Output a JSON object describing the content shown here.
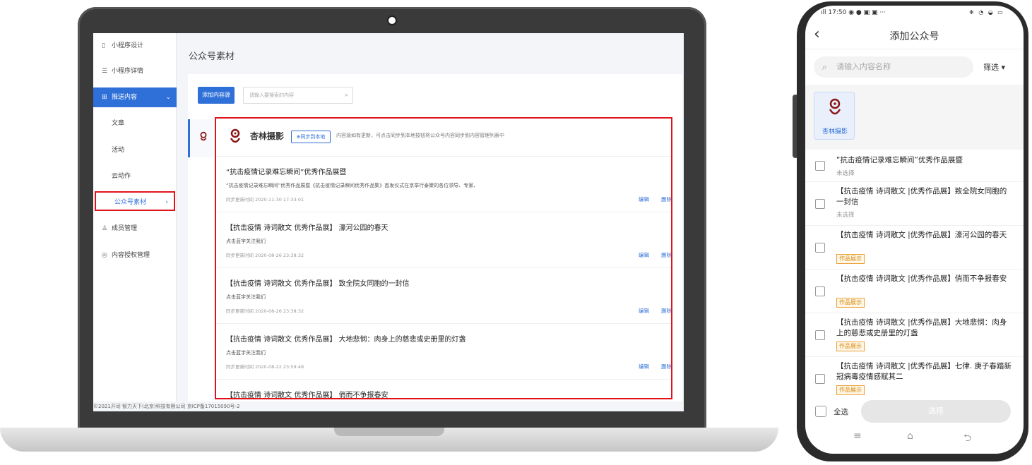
{
  "laptop": {
    "sidebar": {
      "items": [
        {
          "icon": "mini-program-icon",
          "glyph": "▯",
          "label": "小程序设计"
        },
        {
          "icon": "list-icon",
          "glyph": "☰",
          "label": "小程序详情"
        },
        {
          "icon": "content-icon",
          "glyph": "⊞",
          "label": "推送内容",
          "chevron": "⌄"
        },
        {
          "label": "文章"
        },
        {
          "label": "活动"
        },
        {
          "label": "云动作"
        },
        {
          "label": "公众号素材",
          "chevron": "›"
        },
        {
          "icon": "member-icon",
          "glyph": "♙",
          "label": "成员管理"
        },
        {
          "icon": "permission-icon",
          "glyph": "◎",
          "label": "内容授权管理"
        }
      ]
    },
    "footer": "©2021开司 智力天下(北京)科技有限公司 京ICP备17015090号-2",
    "page_title": "公众号素材",
    "add_button": "添加内容源",
    "search_placeholder": "请输入要搜索的内容",
    "account": {
      "name": "杏林摄影",
      "sync_label": "⊕同步到本地",
      "tip": "内容源如有更新，可点击同步到本地按钮将公众号内容同步到内容管理列表中"
    },
    "articles": [
      {
        "title": "“抗击疫情记录难忘瞬间”优秀作品展暨",
        "desc": "“抗击疫情记录难忘瞬间”优秀作品展暨《抗击疫情记录瞬间优秀作品集》首发仪式在京举行泰聚的各位领导、专家、",
        "time": "同步更新时间 2020-11-30 17:33:01"
      },
      {
        "title": "【抗击疫情 诗词散文 优秀作品展】 濠河公园的春天",
        "desc": "点击蓝字关注我们",
        "time": "同步更新时间 2020-08-26 23:38:32"
      },
      {
        "title": "【抗击疫情 诗词散文 优秀作品展】 致全院女同胞的一封信",
        "desc": "点击蓝字关注我们",
        "time": "同步更新时间 2020-08-26 23:38:32"
      },
      {
        "title": "【抗击疫情 诗词散文 优秀作品展】 大地悲悯：肉身上的慈悲或史册里的灯盏",
        "desc": "点击蓝字关注我们",
        "time": "同步更新时间 2020-08-22 23:59:48"
      },
      {
        "title": "【抗击疫情 诗词散文 优秀作品展】 俏而不争报春安",
        "desc": "",
        "time": ""
      }
    ],
    "edit_label": "编辑",
    "delete_label": "删除"
  },
  "phone": {
    "status_time": "17:50",
    "status_left_icons": "◉ ● ▣ ▣ ···",
    "status_right_icons": "✻ ◔ ◒ ▭",
    "title": "添加公众号",
    "search_placeholder": "请输入内容名称",
    "filter_label": "筛选 ▾",
    "account_name": "杏林摄影",
    "items": [
      {
        "title": "“抗击疫情记录难忘瞬间”优秀作品展暨",
        "sub": "未选择"
      },
      {
        "title": "【抗击疫情 诗词散文 |优秀作品展】致全院女同胞的一封信",
        "sub": "未选择"
      },
      {
        "title": "【抗击疫情 诗词散文 |优秀作品展】濠河公园的春天",
        "tag": "作品展示"
      },
      {
        "title": "【抗击疫情 诗词散文 |优秀作品展】俏而不争报春安",
        "tag": "作品展示"
      },
      {
        "title": "【抗击疫情 诗词散文 |优秀作品展】大地悲悯：肉身上的慈悲或史册里的灯盏",
        "tag": "作品展示"
      },
      {
        "title": "【抗击疫情 诗词散文 |优秀作品展】七律. 庚子春踏新冠病毒疫情感赋其二",
        "tag": "作品展示"
      }
    ],
    "select_all_label": "全选",
    "select_button": "选择",
    "sysnav": [
      "≡",
      "⌂",
      "⮌"
    ]
  },
  "colors": {
    "primary": "#2e6fd8",
    "highlight_red": "#e0131b",
    "tag_orange": "#d88a10"
  }
}
